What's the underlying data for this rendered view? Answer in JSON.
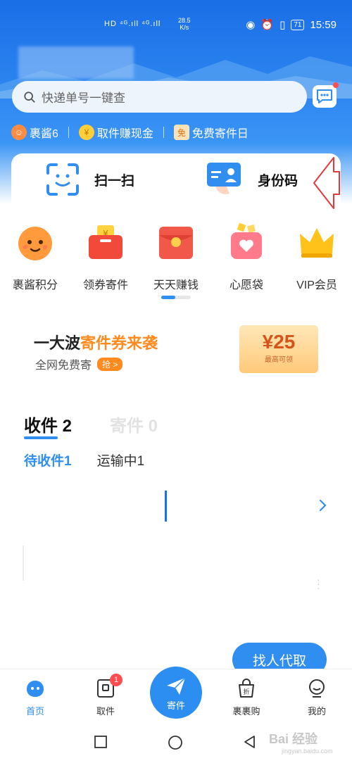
{
  "status_bar": {
    "left": "HD ⁴ᴳ.ıll ⁴ᴳ.ıll",
    "speed_value": "28.5",
    "speed_unit": "K/s",
    "battery": "71",
    "time": "15:59"
  },
  "search": {
    "placeholder": "快递单号一键查"
  },
  "quick_links": [
    {
      "label": "裹酱6"
    },
    {
      "label": "取件赚现金"
    },
    {
      "label": "免费寄件日"
    }
  ],
  "scan_card": {
    "scan_label": "扫一扫",
    "id_code_label": "身份码"
  },
  "services": [
    {
      "label": "裹酱积分"
    },
    {
      "label": "领券寄件"
    },
    {
      "label": "天天赚钱"
    },
    {
      "label": "心愿袋"
    },
    {
      "label": "VIP会员"
    }
  ],
  "banner": {
    "title_prefix": "一大波",
    "title_highlight": "寄件券来袭",
    "subtitle": "全网免费寄",
    "grab": "抢 >",
    "coupon_value": "¥25",
    "coupon_sub": "最高可领"
  },
  "parcel_tabs": {
    "receive": "收件 2",
    "send": "寄件 0"
  },
  "parcel_subtabs": {
    "pending": "待收件1",
    "transit": "运输中1"
  },
  "find_button": "找人代取",
  "tab_bar": {
    "home": "首页",
    "pickup": "取件",
    "pickup_badge": "1",
    "send": "寄件",
    "shop": "裹裹购",
    "mine": "我的"
  },
  "watermark": {
    "main": "Bai 经验",
    "sub": "jingyan.baidu.com"
  },
  "colors": {
    "accent": "#2f8ef0",
    "orange": "#ff8a1f",
    "badge": "#ff4d4f"
  }
}
